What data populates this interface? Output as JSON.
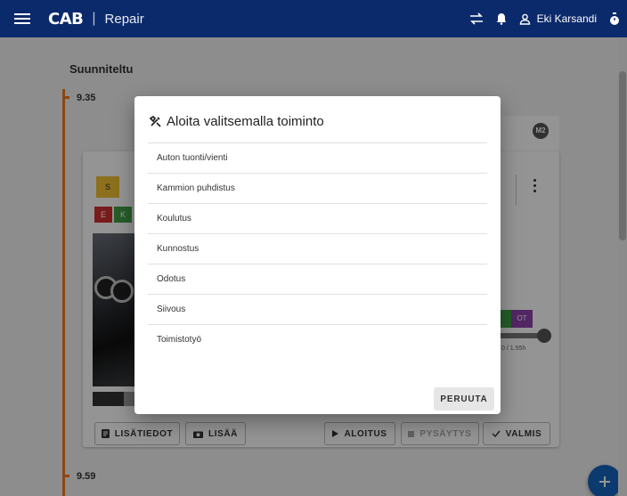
{
  "appbar": {
    "logo": "CAB",
    "separator": "|",
    "title": "Repair",
    "user_name": "Eki Karsandi",
    "color": "#0b2a6b"
  },
  "schedule": {
    "section_title": "Suunniteltu",
    "times": [
      "9.35",
      "9.59"
    ],
    "timeline_color": "#f07a22"
  },
  "card": {
    "badges": {
      "s": "S",
      "e": "E",
      "k": "K",
      "ot": "OT",
      "m2": "M2"
    },
    "progress_text": "0 / 1.55h"
  },
  "actions": {
    "details": "LISÄTIEDOT",
    "add": "LISÄÄ",
    "start": "ALOITUS",
    "pause": "PYSÄYTYS",
    "done": "VALMIS"
  },
  "dialog": {
    "title": "Aloita valitsemalla toiminto",
    "items": [
      "Auton tuonti/vienti",
      "Kammion puhdistus",
      "Koulutus",
      "Kunnostus",
      "Odotus",
      "Siivous",
      "Toimistotyö"
    ],
    "cancel": "PERUUTA"
  }
}
